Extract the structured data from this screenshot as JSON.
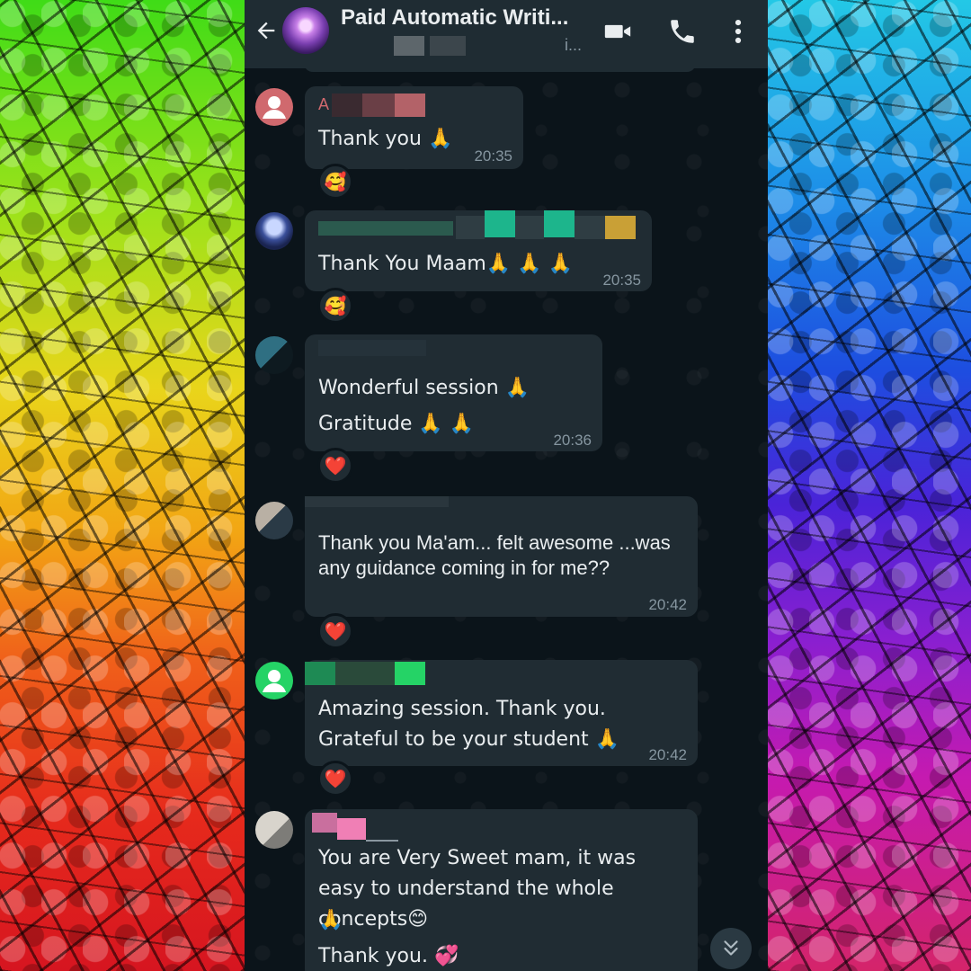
{
  "header": {
    "title": "Paid Automatic Writi...",
    "subtitle_tail": "i...",
    "colors": {
      "bar": "#1f2c33",
      "text": "#e9edef"
    },
    "icons": [
      "back-arrow-icon",
      "video-call-icon",
      "phone-call-icon",
      "more-options-icon"
    ]
  },
  "messages": [
    {
      "sender_initial": "A",
      "text": "Thank you 🙏",
      "time": "20:35",
      "reaction": "🥰"
    },
    {
      "text": "Thank You Maam🙏 🙏 🙏",
      "time": "20:35",
      "reaction": "🥰"
    },
    {
      "line1": "Wonderful session 🙏",
      "line2": "Gratitude 🙏 🙏",
      "time": "20:36",
      "reaction": "❤️"
    },
    {
      "text": "Thank you Ma'am... felt awesome ...was any guidance coming in for me??",
      "time": "20:42",
      "reaction": "❤️"
    },
    {
      "text": "Amazing session. Thank you. Grateful to be your student 🙏",
      "time": "20:42",
      "reaction": "❤️"
    },
    {
      "line1": "You are Very Sweet mam, it was easy to understand the whole concepts😊",
      "line2": "🙏",
      "line3": "Thank you. 💞"
    }
  ],
  "colors": {
    "chat_background": "#0b141a",
    "incoming_bubble": "#202c33",
    "timestamp": "#8696a0",
    "sender_pink": "#d0696e",
    "sender_green": "#25d366"
  },
  "scroll_button_icon": "double-chevron-down-icon"
}
